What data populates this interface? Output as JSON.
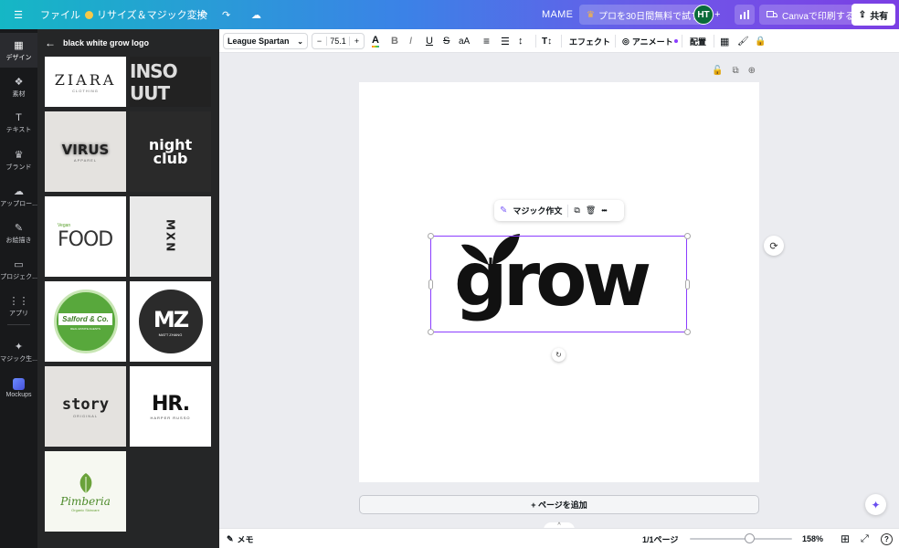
{
  "topbar": {
    "menu_icon": "☰",
    "file": "ファイル",
    "resize": "リサイズ＆マジック変換",
    "undo_icon": "↶",
    "redo_icon": "↷",
    "cloud_icon": "☁",
    "design_name": "MAME",
    "trial": "プロを30日間無料で試す",
    "avatar": "HT",
    "plus_icon": "+",
    "stats_icon": "📊",
    "print": "Canvaで印刷する",
    "share": "共有"
  },
  "rail": [
    {
      "label": "デザイン",
      "icon": "▦"
    },
    {
      "label": "素材",
      "icon": "❖"
    },
    {
      "label": "テキスト",
      "icon": "T"
    },
    {
      "label": "ブランド",
      "icon": "♛"
    },
    {
      "label": "アップロー...",
      "icon": "☁"
    },
    {
      "label": "お絵描き",
      "icon": "✎"
    },
    {
      "label": "プロジェク...",
      "icon": "▭"
    },
    {
      "label": "アプリ",
      "icon": "⋮⋮"
    },
    {
      "label": "マジック生...",
      "icon": "✦"
    },
    {
      "label": "Mockups",
      "icon": ""
    }
  ],
  "panel": {
    "back_icon": "←",
    "query": "black white grow logo",
    "thumbs": [
      {
        "text": "ZIARA",
        "sub": "CLOTHING"
      },
      {
        "text": "INSO UUT",
        "sub": ""
      },
      {
        "text": "VIRUS",
        "sub": "APPAREL"
      },
      {
        "text": "night club",
        "sub": ""
      },
      {
        "text": "FOOD",
        "sub": "Vegan"
      },
      {
        "text": "MXN",
        "sub": ""
      },
      {
        "text": "Salford & Co.",
        "sub": "REAL ESTATE AGENTS"
      },
      {
        "text": "MZ",
        "sub": "MATT ZHANG"
      },
      {
        "text": "story",
        "sub": "ORIGINAL"
      },
      {
        "text": "HR.",
        "sub": "HARPER RUSSO"
      },
      {
        "text": "Pimberia",
        "sub": "Organic Skincare"
      }
    ],
    "collapse_icon": "‹"
  },
  "toolbar": {
    "font": "League Spartan",
    "size_minus": "−",
    "size": "75.1",
    "size_plus": "+",
    "text_color_icon": "A",
    "bold": "B",
    "italic": "I",
    "underline": "U",
    "strike": "S",
    "case": "aA",
    "align_icon": "≡",
    "list_icon": "☰",
    "spacing_icon": "↕",
    "vertical_icon": "T↕",
    "effects": "エフェクト",
    "animate": "アニメート",
    "position": "配置",
    "transparency_icon": "▦",
    "paint_icon": "🖌",
    "lock_icon": "🔒"
  },
  "canvas": {
    "lock_icon": "🔓",
    "duplicate_icon": "⧉",
    "add_icon": "⊕",
    "popup_magic": "マジック作文",
    "popup_copy_icon": "⧉",
    "popup_delete_icon": "🗑",
    "popup_more_icon": "•••",
    "logo_text": "grow",
    "rotate_icon": "↻",
    "side_refresh_icon": "⟳",
    "add_page": "+ ページを追加",
    "scroll_up_icon": "^",
    "magic_icon": "✦"
  },
  "bottombar": {
    "notes": "メモ",
    "pages": "1/1ページ",
    "zoom": "158%",
    "grid_icon": "⊞",
    "fullscreen_icon": "⤢",
    "help_icon": "?",
    "zoom_value": 0.58
  }
}
